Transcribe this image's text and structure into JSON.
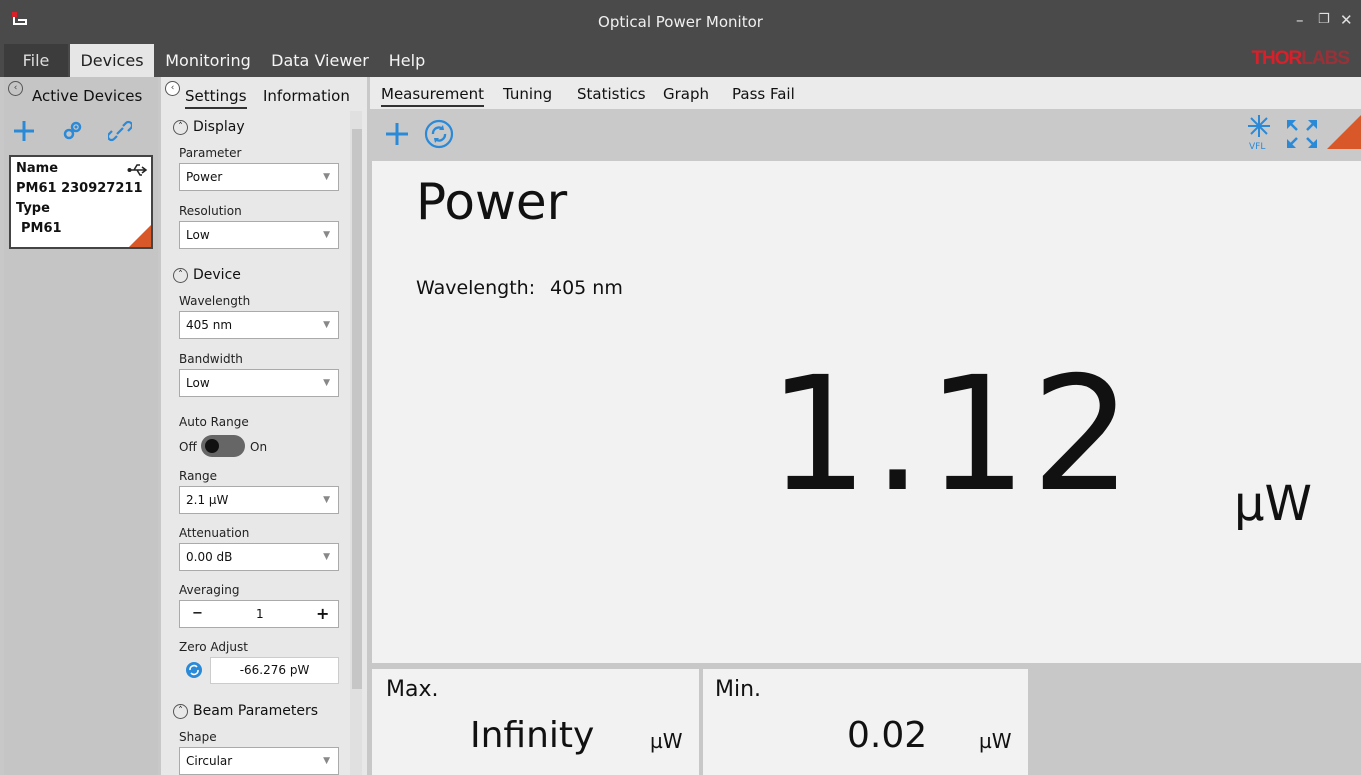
{
  "window": {
    "title": "Optical Power Monitor",
    "minimize_glyph": "–",
    "restore_glyph": "❐",
    "close_glyph": "✕"
  },
  "menu": {
    "file": "File",
    "devices": "Devices",
    "monitoring": "Monitoring",
    "data_viewer": "Data Viewer",
    "help": "Help",
    "logo_main": "THOR",
    "logo_faded": "LABS"
  },
  "active_devices": {
    "header": "Active Devices",
    "device": {
      "name_label": "Name",
      "name_value": "PM61 230927211",
      "type_label": "Type",
      "type_value": "PM61",
      "connection_icon": "usb-icon"
    }
  },
  "settings": {
    "tab_settings": "Settings",
    "tab_information": "Information",
    "display_section": "Display",
    "parameter_label": "Parameter",
    "parameter_value": "Power",
    "resolution_label": "Resolution",
    "resolution_value": "Low",
    "device_section": "Device",
    "wavelength_label": "Wavelength",
    "wavelength_value": "405 nm",
    "bandwidth_label": "Bandwidth",
    "bandwidth_value": "Low",
    "auto_range_label": "Auto Range",
    "auto_range_off": "Off",
    "auto_range_on": "On",
    "range_label": "Range",
    "range_value": "2.1 µW",
    "attenuation_label": "Attenuation",
    "attenuation_value": "0.00 dB",
    "averaging_label": "Averaging",
    "averaging_value": "1",
    "averaging_minus": "−",
    "averaging_plus": "+",
    "zero_adjust_label": "Zero Adjust",
    "zero_adjust_value": "-66.276 pW",
    "beam_section": "Beam Parameters",
    "shape_label": "Shape",
    "shape_value": "Circular"
  },
  "main_tabs": {
    "measurement": "Measurement",
    "tuning": "Tuning",
    "statistics": "Statistics",
    "graph": "Graph",
    "pass_fail": "Pass Fail"
  },
  "measurement": {
    "title": "Power",
    "wavelength_label": "Wavelength:",
    "wavelength_value": "405 nm",
    "value": "1.12",
    "unit": "µW",
    "vfl_label": "VFL"
  },
  "stats": {
    "max_label": "Max.",
    "max_value": "Infinity",
    "max_unit": "µW",
    "min_label": "Min.",
    "min_value": "0.02",
    "min_unit": "µW"
  },
  "colors": {
    "accent_blue": "#2a8ad8",
    "orange": "#d9582a",
    "title_bar": "#4a4a4a"
  }
}
